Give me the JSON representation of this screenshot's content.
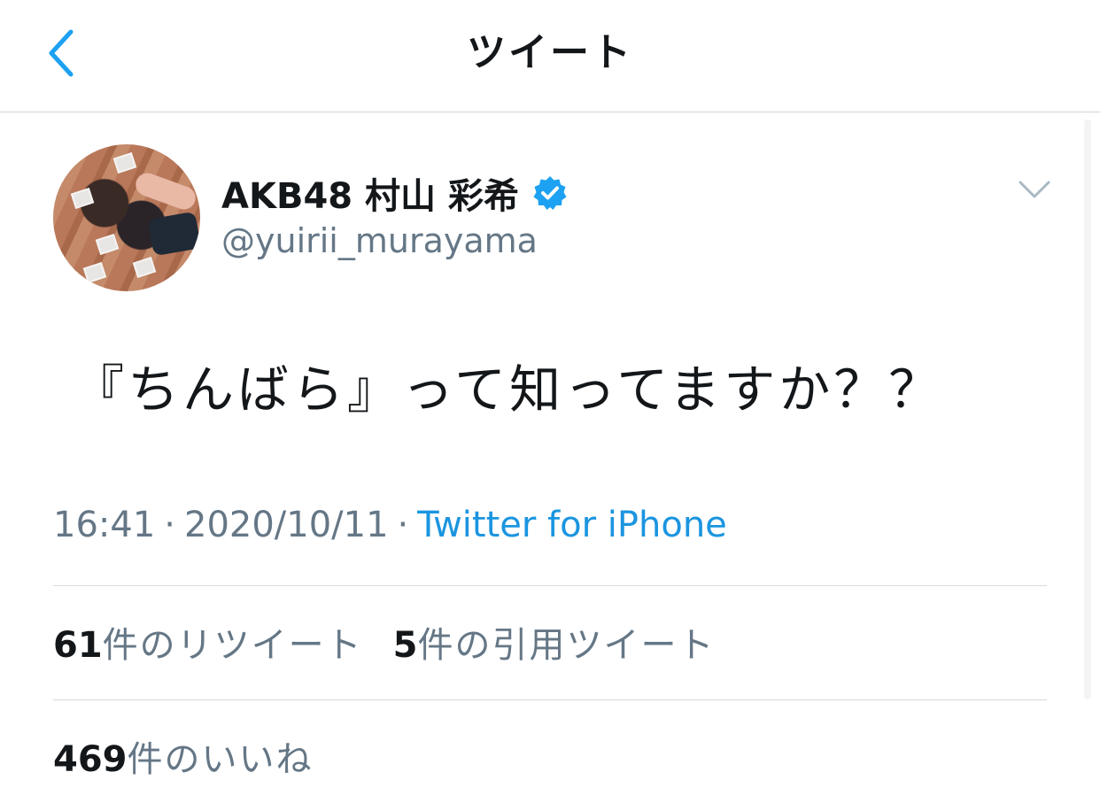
{
  "header": {
    "title": "ツイート",
    "back_icon": "chevron-left-icon"
  },
  "author": {
    "display_name": "AKB48 村山 彩希",
    "handle": "@yuirii_murayama",
    "verified": true,
    "avatar": "profile-photo"
  },
  "tweet": {
    "text": "『ちんばら』って知ってますか？？",
    "time": "16:41",
    "date": "2020/10/11",
    "separator": "·",
    "source": "Twitter for iPhone"
  },
  "stats": {
    "retweets": {
      "count": "61",
      "label": "件のリツイート"
    },
    "quotes": {
      "count": "5",
      "label": "件の引用ツイート"
    },
    "likes": {
      "count": "469",
      "label": "件のいいね"
    }
  },
  "colors": {
    "accent": "#1b95e0",
    "secondary_text": "#657786",
    "primary_text": "#14171a",
    "divider": "#d5dbe0"
  }
}
